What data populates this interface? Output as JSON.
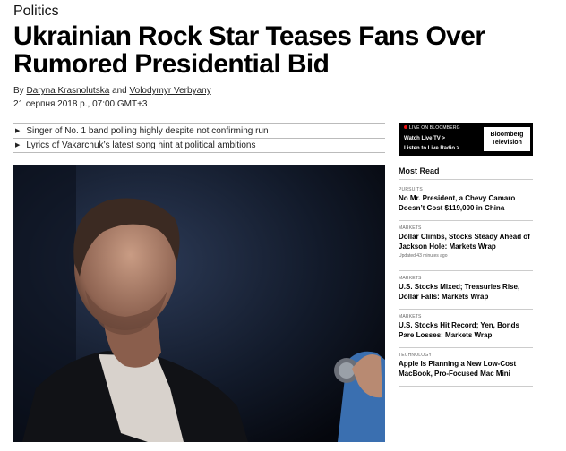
{
  "article": {
    "section": "Politics",
    "headline_line1": "Ukrainian Rock Star Teases Fans Over",
    "headline_line2": "Rumored Presidential Bid",
    "byline_prefix": "By",
    "author1": "Daryna Krasnolutska",
    "byline_and": "and",
    "author2": "Volodymyr Verbyany",
    "dateline": "21 серпня 2018 р., 07:00 GMT+3",
    "bullets": [
      "Singer of No. 1 band polling highly despite not confirming run",
      "Lyrics of Vakarchuk’s latest song hint at political ambitions"
    ]
  },
  "promo": {
    "live_label": "LIVE ON BLOOMBERG",
    "watch_label": "Watch Live TV >",
    "listen_label": "Listen to Live Radio >",
    "logo_line1": "Bloomberg",
    "logo_line2": "Television"
  },
  "most_read": {
    "title": "Most Read",
    "items": [
      {
        "category": "PURSUITS",
        "headline": "No Mr. President, a Chevy Camaro Doesn’t Cost $119,000 in China",
        "updated": ""
      },
      {
        "category": "MARKETS",
        "headline": "Dollar Climbs, Stocks Steady Ahead of Jackson Hole: Markets Wrap",
        "updated": "Updated 43 minutes ago"
      },
      {
        "category": "MARKETS",
        "headline": "U.S. Stocks Mixed; Treasuries Rise, Dollar Falls: Markets Wrap",
        "updated": ""
      },
      {
        "category": "MARKETS",
        "headline": "U.S. Stocks Hit Record; Yen, Bonds Pare Losses: Markets Wrap",
        "updated": ""
      },
      {
        "category": "TECHNOLOGY",
        "headline": "Apple Is Planning a New Low-Cost MacBook, Pro-Focused Mac Mini",
        "updated": ""
      }
    ]
  },
  "colors": {
    "live_dot": "#e11111",
    "promo_bg": "#000000"
  },
  "icons": {
    "bullet": "triangle-right-icon"
  }
}
